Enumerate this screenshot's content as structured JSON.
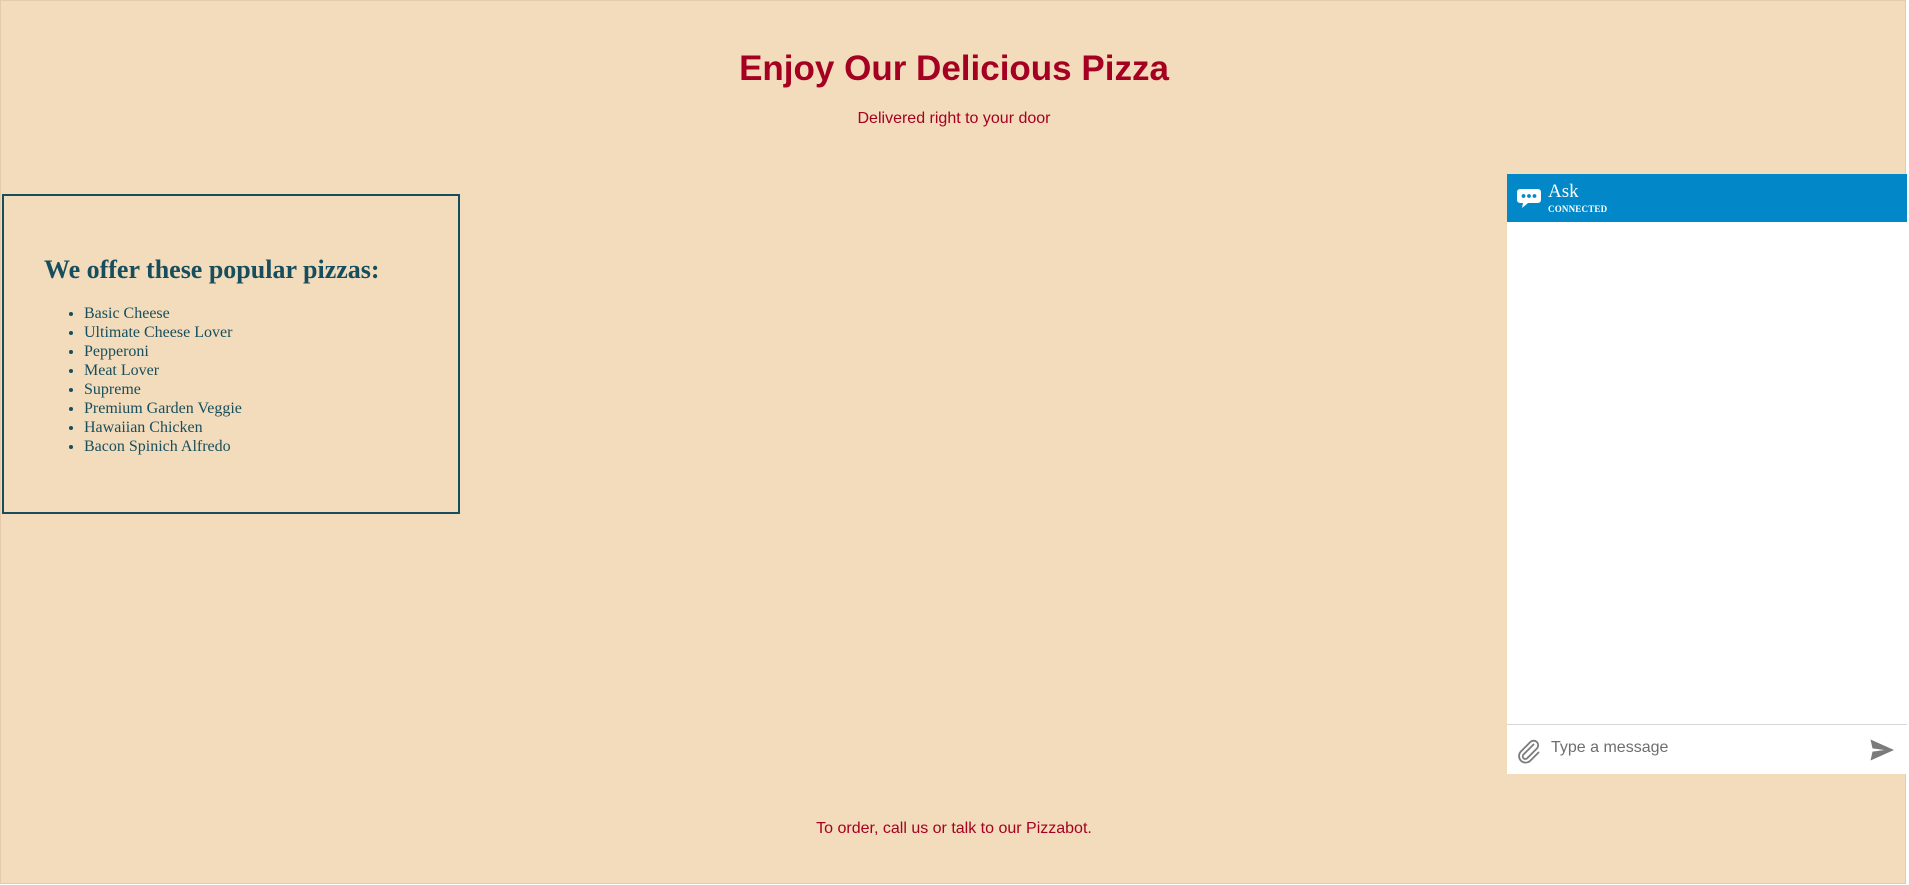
{
  "hero": {
    "title": "Enjoy Our Delicious Pizza",
    "subtitle": "Delivered right to your door"
  },
  "menu": {
    "heading": "We offer these popular pizzas:",
    "items": [
      "Basic Cheese",
      "Ultimate Cheese Lover",
      "Pepperoni",
      "Meat Lover",
      "Supreme",
      "Premium Garden Veggie",
      "Hawaiian Chicken",
      "Bacon Spinich Alfredo"
    ]
  },
  "footer": {
    "text": "To order, call us or talk to our Pizzabot."
  },
  "chat": {
    "title": "Ask",
    "status": "CONNECTED",
    "header_icon": "chat-bubble-icon",
    "attach_icon": "paperclip-icon",
    "send_icon": "send-icon",
    "input_placeholder": "Type a message",
    "input_value": ""
  },
  "colors": {
    "page_background": "#f3dcbc",
    "accent_red": "#a50021",
    "menu_teal": "#174e5d",
    "chat_header_blue": "#0288c9",
    "icon_gray": "#7b7b7b"
  }
}
